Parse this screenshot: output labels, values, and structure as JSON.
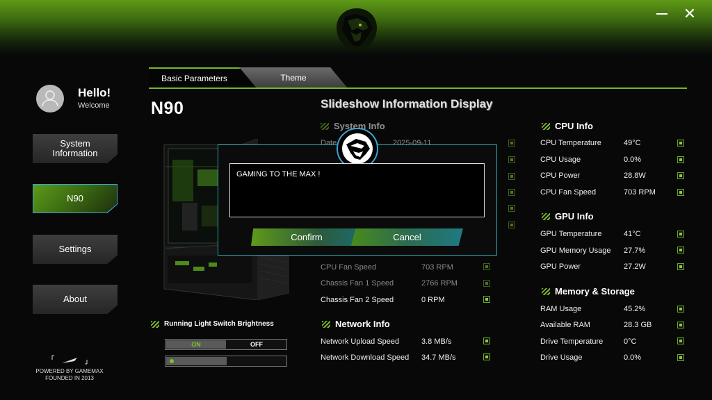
{
  "window": {
    "minimize_label": "Minimize",
    "close_label": "Close"
  },
  "user": {
    "greeting": "Hello!",
    "welcome": "Welcome"
  },
  "sidebar": {
    "items": [
      {
        "label": "System\nInformation",
        "active": false
      },
      {
        "label": "N90",
        "active": true
      },
      {
        "label": "Settings",
        "active": false
      },
      {
        "label": "About",
        "active": false
      }
    ],
    "powered_line1": "POWERED BY GAMEMAX",
    "powered_line2": "FOUNDED IN 2013"
  },
  "tabs": [
    {
      "label": "Basic Parameters",
      "active": true
    },
    {
      "label": "Theme",
      "active": false
    }
  ],
  "model_title": "N90",
  "slideshow_title": "Slideshow Information Display",
  "system_info": {
    "title": "System Info",
    "rows": [
      {
        "label": "Date",
        "value": "2025-09-11"
      }
    ]
  },
  "fans": [
    {
      "label": "CPU Fan Speed",
      "value": "703 RPM"
    },
    {
      "label": "Chassis Fan 1 Speed",
      "value": "2766 RPM"
    },
    {
      "label": "Chassis Fan 2 Speed",
      "value": "0 RPM"
    }
  ],
  "network_info": {
    "title": "Network Info",
    "rows": [
      {
        "label": "Network Upload Speed",
        "value": "3.8 MB/s"
      },
      {
        "label": "Network Download Speed",
        "value": "34.7 MB/s"
      }
    ]
  },
  "cpu_info": {
    "title": "CPU Info",
    "rows": [
      {
        "label": "CPU Temperature",
        "value": "49°C"
      },
      {
        "label": "CPU Usage",
        "value": "0.0%"
      },
      {
        "label": "CPU Power",
        "value": "28.8W"
      },
      {
        "label": "CPU Fan Speed",
        "value": "703 RPM"
      }
    ]
  },
  "gpu_info": {
    "title": "GPU Info",
    "rows": [
      {
        "label": "GPU Temperature",
        "value": "41°C"
      },
      {
        "label": "GPU Memory Usage",
        "value": "27.7%"
      },
      {
        "label": "GPU Power",
        "value": "27.2W"
      }
    ]
  },
  "memory_info": {
    "title": "Memory & Storage",
    "rows": [
      {
        "label": "RAM Usage",
        "value": "45.2%"
      },
      {
        "label": "Available RAM",
        "value": "28.3 GB"
      },
      {
        "label": "Drive Temperature",
        "value": "0°C"
      },
      {
        "label": "Drive Usage",
        "value": "0.0%"
      }
    ]
  },
  "running_light": {
    "title": "Running Light Switch Brightness",
    "on_label": "ON",
    "off_label": "OFF",
    "state": "ON",
    "brightness": 0.5
  },
  "dialog": {
    "text": "GAMING TO THE MAX !",
    "confirm_label": "Confirm",
    "cancel_label": "Cancel"
  },
  "colors": {
    "accent": "#79b62b",
    "dialog_border": "#2fa3b0",
    "active_border": "#3aa3d3"
  }
}
